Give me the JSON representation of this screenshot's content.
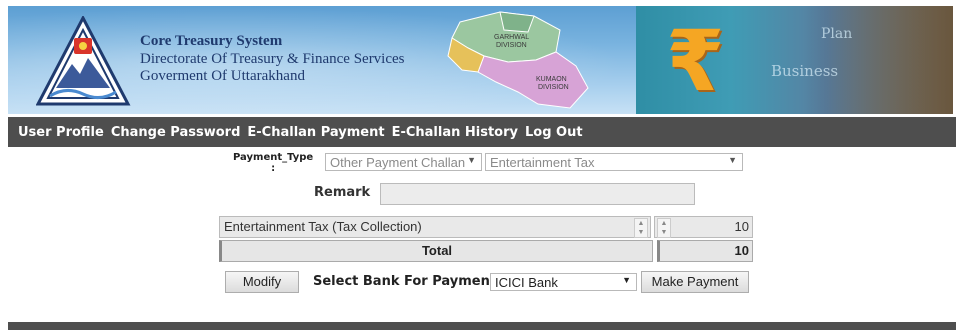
{
  "header": {
    "title": "Core Treasury System",
    "subtitle1": "Directorate Of Treasury & Finance Services",
    "subtitle2": "Goverment Of Uttarakhand",
    "map_labels": [
      "GARHWAL",
      "DIVISION",
      "KUMAON",
      "DIVISION"
    ],
    "photo_words": [
      "Business",
      "Plan"
    ]
  },
  "nav": {
    "items": [
      "User Profile",
      "Change Password",
      "E-Challan Payment",
      "E-Challan History",
      "Log Out"
    ]
  },
  "form": {
    "payment_type_label_1": "Payment_Type",
    "payment_type_label_2": ":",
    "payment_type_value": "Other Payment Challan",
    "sub_type_value": "Entertainment Tax",
    "remark_label": "Remark",
    "remark_value": "",
    "row_label": "Entertainment Tax (Tax Collection)",
    "row_amount": "10",
    "total_label": "Total",
    "total_value": "10",
    "modify_label": "Modify",
    "bank_label": "Select Bank For Payment :",
    "bank_value": "ICICI Bank",
    "make_payment_label": "Make Payment"
  },
  "icons": {
    "dropdown": "▼",
    "spin_up": "▲",
    "spin_down": "▼",
    "rupee": "₹"
  },
  "colors": {
    "nav_bg": "#4e4e4e",
    "banner_blue": "#79b3df",
    "title_text": "#1f3a6e",
    "rupee": "#f5a623"
  }
}
